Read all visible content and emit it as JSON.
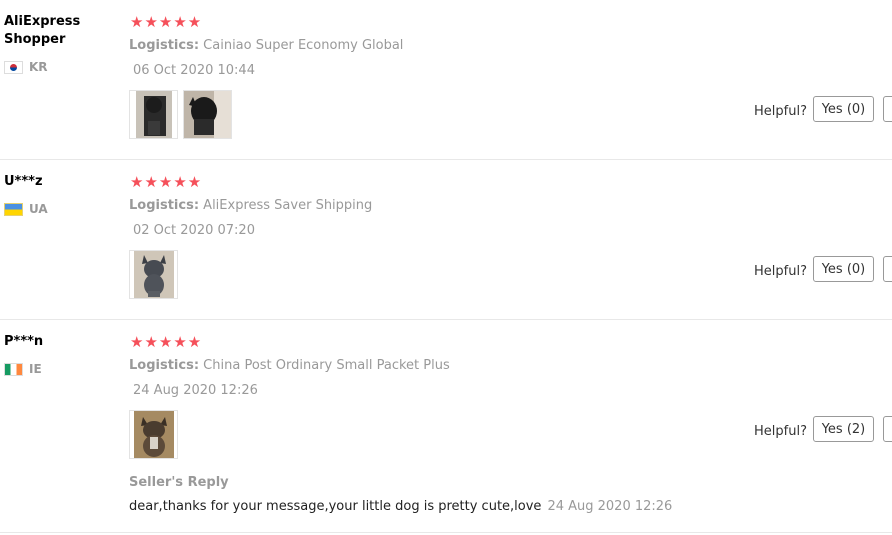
{
  "helpful_label": "Helpful?",
  "reviews": [
    {
      "user": "AliExpress Shopper",
      "country": "KR",
      "stars": "★★★★★",
      "logistics_label": "Logistics:",
      "logistics_value": "Cainiao Super Economy Global",
      "date": "06 Oct 2020 10:44",
      "yes_label": "Yes (0)",
      "images": [
        "dog-photo-1",
        "dog-photo-2"
      ]
    },
    {
      "user": "U***z",
      "country": "UA",
      "stars": "★★★★★",
      "logistics_label": "Logistics:",
      "logistics_value": "AliExpress Saver Shipping",
      "date": "02 Oct 2020 07:20",
      "yes_label": "Yes (0)",
      "images": [
        "dog-photo-1"
      ]
    },
    {
      "user": "P***n",
      "country": "IE",
      "stars": "★★★★★",
      "logistics_label": "Logistics:",
      "logistics_value": "China Post Ordinary Small Packet Plus",
      "date": "24 Aug 2020 12:26",
      "yes_label": "Yes (2)",
      "images": [
        "dog-photo-1"
      ],
      "reply_title": "Seller's Reply",
      "reply_text": "dear,thanks for your message,your little dog is pretty cute,love",
      "reply_date": "24 Aug 2020 12:26"
    }
  ]
}
